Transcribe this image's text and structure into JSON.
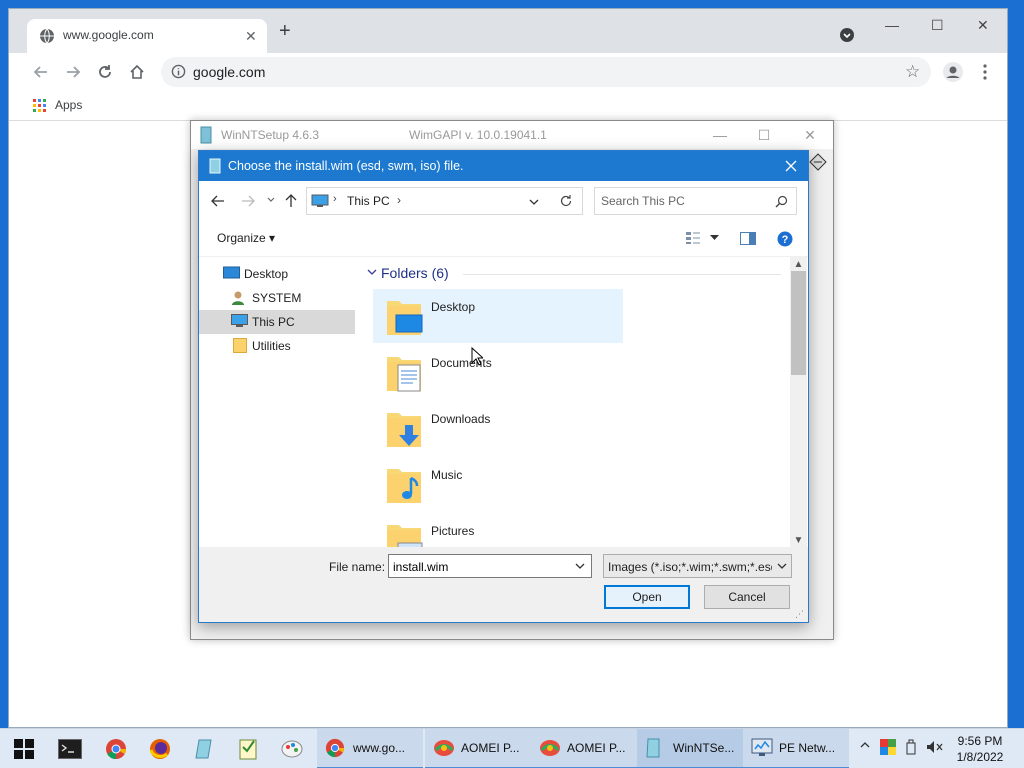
{
  "browser": {
    "tab_title": "www.google.com",
    "url": "google.com",
    "bookmarks_apps": "Apps"
  },
  "background_window": {
    "title": "WinNTSetup 4.6.3",
    "subtitle": "WimGAPI v. 10.0.19041.1"
  },
  "dialog": {
    "title": "Choose the install.wim (esd, swm, iso) file.",
    "breadcrumb": "This PC",
    "search_placeholder": "Search This PC",
    "organize_label": "Organize",
    "nav_items": [
      "Desktop",
      "SYSTEM",
      "This PC",
      "Utilities"
    ],
    "group_header": "Folders (6)",
    "folders": [
      "Desktop",
      "Documents",
      "Downloads",
      "Music",
      "Pictures"
    ],
    "file_name_label": "File name:",
    "file_name_value": "install.wim",
    "file_type_filter": "Images (*.iso;*.wim;*.swm;*.esd)",
    "open_label": "Open",
    "cancel_label": "Cancel"
  },
  "taskbar": {
    "tasks": [
      {
        "label": "www.go...",
        "icon": "chrome-icon"
      },
      {
        "label": "AOMEI P...",
        "icon": "aomei-icon"
      },
      {
        "label": "AOMEI P...",
        "icon": "aomei-icon"
      },
      {
        "label": "WinNTSe...",
        "icon": "winntsetup-icon"
      },
      {
        "label": "PE Netw...",
        "icon": "network-icon"
      }
    ],
    "time": "9:56 PM",
    "date": "1/8/2022"
  },
  "colors": {
    "desktop": "#1c6fd2",
    "dialog_title": "#1c79cf",
    "selection": "#e5f3ff",
    "accent": "#0078d7"
  }
}
